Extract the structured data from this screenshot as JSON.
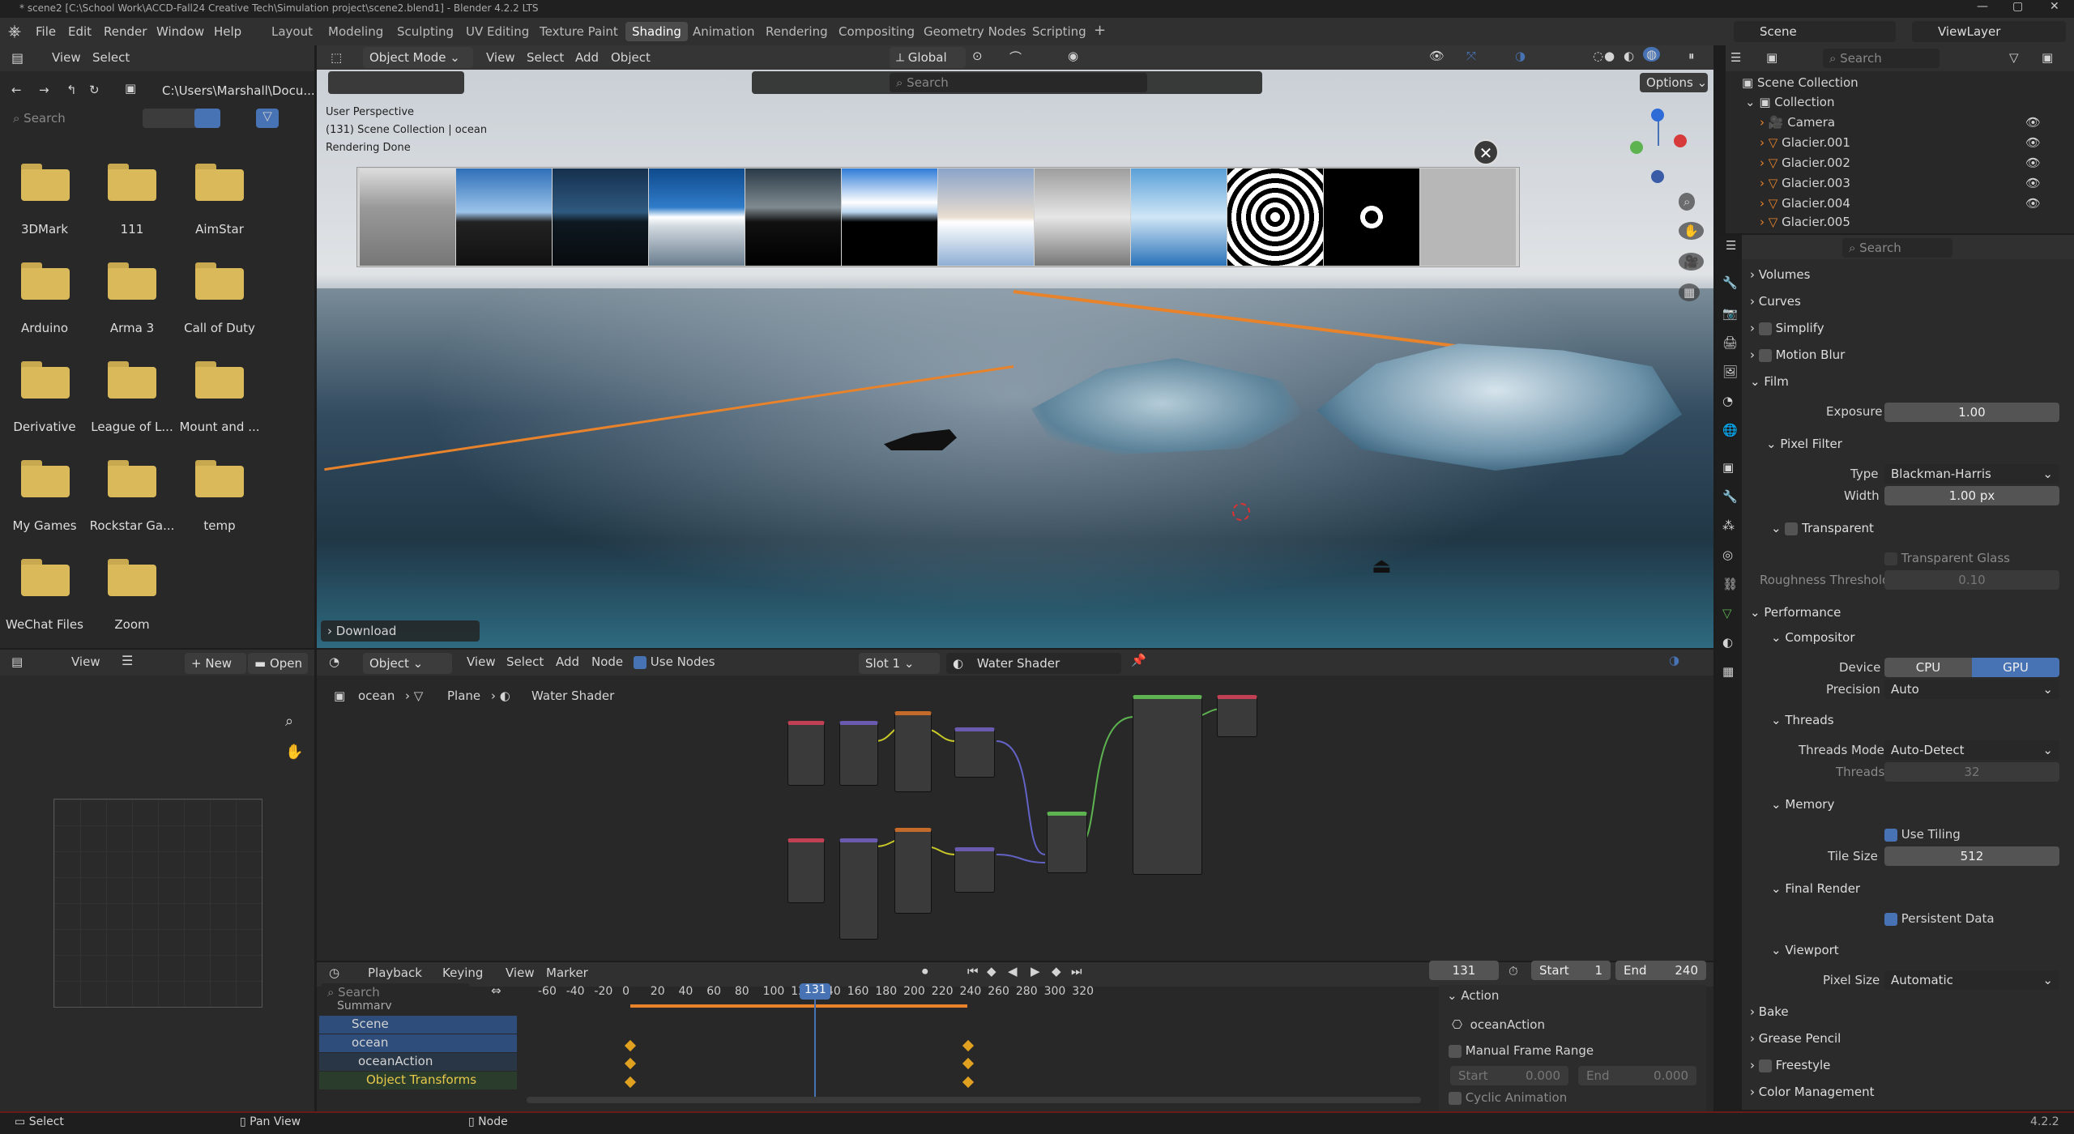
{
  "titlebar": {
    "title": "* scene2 [C:\\School Work\\ACCD-Fall24 Creative Tech\\Simulation project\\scene2.blend1] - Blender 4.2.2 LTS"
  },
  "menu": [
    "File",
    "Edit",
    "Render",
    "Window",
    "Help"
  ],
  "workspaces": [
    "Layout",
    "Modeling",
    "Sculpting",
    "UV Editing",
    "Texture Paint",
    "Shading",
    "Animation",
    "Rendering",
    "Compositing",
    "Geometry Nodes",
    "Scripting"
  ],
  "active_workspace": "Shading",
  "scene": {
    "name": "Scene",
    "view_layer": "ViewLayer"
  },
  "filebrowser": {
    "view": "View",
    "select": "Select",
    "path": "C:\\Users\\Marshall\\Docu...",
    "search_placeholder": "Search",
    "folders": [
      "3DMark",
      "111",
      "AimStar",
      "Arduino",
      "Arma 3",
      "Call of Duty",
      "Derivative",
      "League of L...",
      "Mount and ...",
      "My Games",
      "Rockstar Ga...",
      "temp",
      "WeChat Files",
      "Zoom"
    ]
  },
  "viewport": {
    "mode": "Object Mode",
    "view": "View",
    "select": "Select",
    "add": "Add",
    "object": "Object",
    "orientation": "Global",
    "options": "Options",
    "search_placeholder": "Search",
    "info1": "User Perspective",
    "info2": "(131) Scene Collection | ocean",
    "info3": "Rendering Done",
    "download": "Download"
  },
  "image_editor": {
    "view": "View",
    "new": "New",
    "open": "Open"
  },
  "shader": {
    "object": "Object",
    "view": "View",
    "select": "Select",
    "add": "Add",
    "node": "Node",
    "use_nodes": "Use Nodes",
    "slot": "Slot 1",
    "material": "Water Shader",
    "crumb1": "ocean",
    "crumb2": "Plane",
    "crumb3": "Water Shader"
  },
  "timeline": {
    "playback": "Playback",
    "keying": "Keying",
    "view": "View",
    "marker": "Marker",
    "frame": "131",
    "start_label": "Start",
    "start": "1",
    "end_label": "End",
    "end": "240",
    "ticks": [
      "-60",
      "-40",
      "-20",
      "0",
      "20",
      "40",
      "60",
      "80",
      "100",
      "120",
      "140",
      "160",
      "180",
      "200",
      "220",
      "240",
      "260",
      "280",
      "300",
      "320"
    ],
    "current_frame": 131,
    "search_placeholder": "Search",
    "channels": [
      "Summary",
      "Scene",
      "ocean",
      "oceanAction",
      "Object Transforms"
    ],
    "action_panel": {
      "title": "Action",
      "action": "oceanAction",
      "manual": "Manual Frame Range",
      "start_label": "Start",
      "start": "0.000",
      "end_label": "End",
      "end": "0.000",
      "cyclic": "Cyclic Animation"
    }
  },
  "outliner": {
    "search_placeholder": "Search",
    "root": "Scene Collection",
    "collection": "Collection",
    "items": [
      "Camera",
      "Glacier.001",
      "Glacier.002",
      "Glacier.003",
      "Glacier.004",
      "Glacier.005"
    ]
  },
  "properties": {
    "search_placeholder": "Search",
    "volumes": "Volumes",
    "curves": "Curves",
    "simplify": "Simplify",
    "motion_blur": "Motion Blur",
    "film": "Film",
    "exposure_label": "Exposure",
    "exposure": "1.00",
    "pixel_filter": "Pixel Filter",
    "type_label": "Type",
    "type": "Blackman-Harris",
    "width_label": "Width",
    "width": "1.00 px",
    "transparent": "Transparent",
    "transparent_glass": "Transparent Glass",
    "roughness_label": "Roughness Threshold",
    "roughness": "0.10",
    "performance": "Performance",
    "compositor": "Compositor",
    "device_label": "Device",
    "cpu": "CPU",
    "gpu": "GPU",
    "precision_label": "Precision",
    "precision": "Auto",
    "threads": "Threads",
    "threads_mode_label": "Threads Mode",
    "threads_mode": "Auto-Detect",
    "threads_label": "Threads",
    "threads_value": "32",
    "memory": "Memory",
    "use_tiling": "Use Tiling",
    "tile_label": "Tile Size",
    "tile": "512",
    "final_render": "Final Render",
    "persistent": "Persistent Data",
    "viewport": "Viewport",
    "pixel_size_label": "Pixel Size",
    "pixel_size": "Automatic",
    "bake": "Bake",
    "grease_pencil": "Grease Pencil",
    "freestyle": "Freestyle",
    "color_mgmt": "Color Management"
  },
  "statusbar": {
    "select": "Select",
    "pan": "Pan View",
    "node": "Node",
    "version": "4.2.2"
  },
  "colors": {
    "accent": "#4772b3",
    "selection": "#2e4d7b",
    "orange": "#e8832b",
    "keyframe": "#e0a020"
  }
}
